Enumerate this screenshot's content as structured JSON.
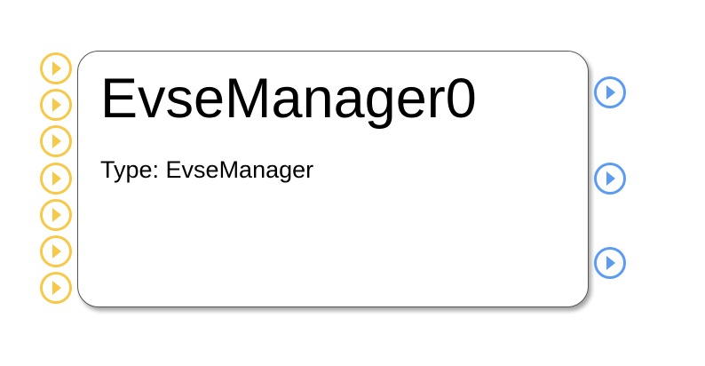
{
  "module": {
    "title": "EvseManager0",
    "type_label": "Type: EvseManager"
  },
  "ports": {
    "input_count": 7,
    "output_count": 3,
    "input_icon": "play-circle-icon",
    "output_icon": "play-circle-icon"
  },
  "colors": {
    "input_port": "#F7C948",
    "output_port": "#5B9CF2",
    "card_border": "#555555",
    "card_background": "#FFFFFF",
    "text": "#000000"
  }
}
